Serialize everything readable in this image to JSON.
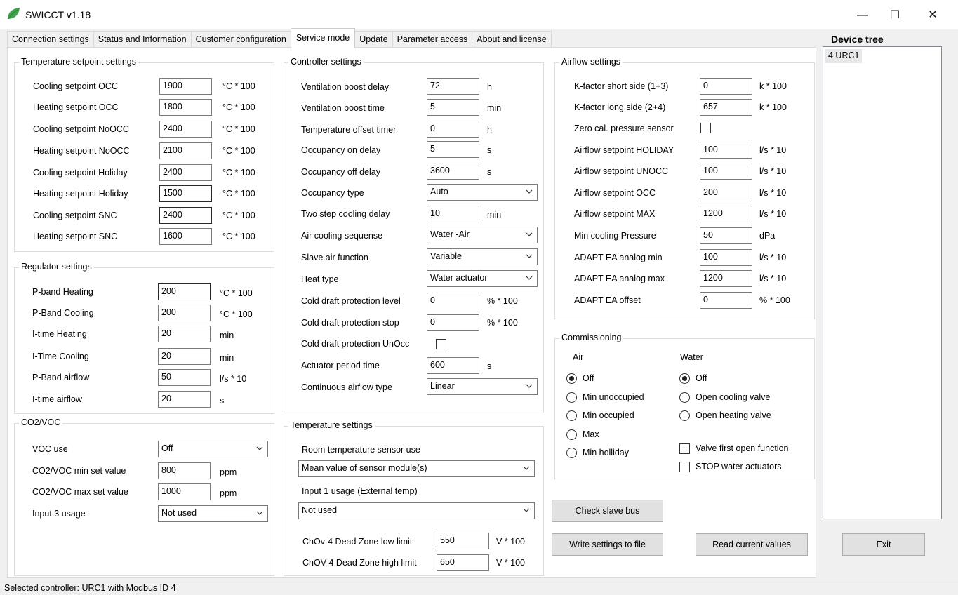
{
  "window": {
    "title": "SWICCT v1.18",
    "minimize": "—",
    "maximize": "☐",
    "close": "✕"
  },
  "tabs": [
    {
      "label": "Connection settings"
    },
    {
      "label": "Status and Information"
    },
    {
      "label": "Customer configuration"
    },
    {
      "label": "Service mode",
      "active": true
    },
    {
      "label": "Update"
    },
    {
      "label": "Parameter access"
    },
    {
      "label": "About and license"
    }
  ],
  "temperature_setpoint": {
    "title": "Temperature setpoint settings",
    "rows": [
      {
        "label": "Cooling setpoint OCC",
        "value": "1900",
        "unit": "°C * 100"
      },
      {
        "label": "Heating setpoint OCC",
        "value": "1800",
        "unit": "°C * 100"
      },
      {
        "label": "Cooling setpoint NoOCC",
        "value": "2400",
        "unit": "°C * 100"
      },
      {
        "label": "Heating setpoint NoOCC",
        "value": "2100",
        "unit": "°C * 100"
      },
      {
        "label": "Cooling setpoint Holiday",
        "value": "2400",
        "unit": "°C * 100"
      },
      {
        "label": "Heating setpoint Holiday",
        "value": "1500",
        "unit": "°C * 100"
      },
      {
        "label": "Cooling setpoint SNC",
        "value": "2400",
        "unit": "°C * 100"
      },
      {
        "label": "Heating setpoint SNC",
        "value": "1600",
        "unit": "°C * 100"
      }
    ]
  },
  "regulator": {
    "title": "Regulator settings",
    "rows": [
      {
        "label": "P-band Heating",
        "value": "200",
        "unit": "°C * 100"
      },
      {
        "label": "P-Band Cooling",
        "value": "200",
        "unit": "°C * 100"
      },
      {
        "label": "I-time Heating",
        "value": "20",
        "unit": "min"
      },
      {
        "label": "I-Time Cooling",
        "value": "20",
        "unit": "min"
      },
      {
        "label": "P-Band airflow",
        "value": "50",
        "unit": "l/s * 10"
      },
      {
        "label": "I-time airflow",
        "value": "20",
        "unit": "s"
      }
    ]
  },
  "co2voc": {
    "title": "CO2/VOC",
    "voc_use_label": "VOC use",
    "voc_use_value": "Off",
    "min_label": "CO2/VOC min set value",
    "min_value": "800",
    "min_unit": "ppm",
    "max_label": "CO2/VOC max set value",
    "max_value": "1000",
    "max_unit": "ppm",
    "input3_label": "Input 3 usage",
    "input3_value": "Not used"
  },
  "controller": {
    "title": "Controller settings",
    "rows": [
      {
        "label": "Ventilation boost delay",
        "value": "72",
        "unit": "h"
      },
      {
        "label": "Ventilation boost time",
        "value": "5",
        "unit": "min"
      },
      {
        "label": "Temperature offset timer",
        "value": "0",
        "unit": "h"
      },
      {
        "label": "Occupancy on delay",
        "value": "5",
        "unit": "s"
      },
      {
        "label": "Occupancy off delay",
        "value": "3600",
        "unit": "s"
      }
    ],
    "occupancy_type_label": "Occupancy type",
    "occupancy_type_value": "Auto",
    "two_step_label": "Two step cooling delay",
    "two_step_value": "10",
    "two_step_unit": "min",
    "air_cooling_label": "Air cooling sequense",
    "air_cooling_value": "Water -Air",
    "slave_air_label": "Slave air function",
    "slave_air_value": "Variable",
    "heat_type_label": "Heat type",
    "heat_type_value": "Water actuator",
    "cold_level_label": "Cold draft protection level",
    "cold_level_value": "0",
    "cold_level_unit": "% * 100",
    "cold_stop_label": "Cold draft protection stop",
    "cold_stop_value": "0",
    "cold_stop_unit": "% * 100",
    "cold_unocc_label": "Cold draft protection UnOcc",
    "actuator_label": "Actuator period time",
    "actuator_value": "600",
    "actuator_unit": "s",
    "cont_airflow_label": "Continuous airflow type",
    "cont_airflow_value": "Linear"
  },
  "temperature_settings": {
    "title": "Temperature settings",
    "room_sensor_label": "Room temperature sensor use",
    "room_sensor_value": "Mean value of sensor module(s)",
    "input1_label": "Input 1 usage (External temp)",
    "input1_value": "Not used",
    "low_label": "ChOv-4 Dead Zone low limit",
    "low_value": "550",
    "low_unit": "V * 100",
    "high_label": "ChOV-4 Dead Zone high limit",
    "high_value": "650",
    "high_unit": "V * 100"
  },
  "airflow": {
    "title": "Airflow settings",
    "kshort_label": "K-factor short side (1+3)",
    "kshort_value": "0",
    "kshort_unit": "k * 100",
    "klong_label": "K-factor long side (2+4)",
    "klong_value": "657",
    "klong_unit": "k * 100",
    "zero_label": "Zero cal. pressure sensor",
    "rows": [
      {
        "label": "Airflow setpoint HOLIDAY",
        "value": "100",
        "unit": "l/s * 10"
      },
      {
        "label": "Airflow setpoint UNOCC",
        "value": "100",
        "unit": "l/s * 10"
      },
      {
        "label": "Airflow setpoint OCC",
        "value": "200",
        "unit": "l/s * 10"
      },
      {
        "label": "Airflow setpoint MAX",
        "value": "1200",
        "unit": "l/s * 10"
      },
      {
        "label": "Min cooling Pressure",
        "value": "50",
        "unit": "dPa"
      },
      {
        "label": "ADAPT EA analog min",
        "value": "100",
        "unit": "l/s * 10"
      },
      {
        "label": "ADAPT EA analog max",
        "value": "1200",
        "unit": "l/s * 10"
      },
      {
        "label": "ADAPT EA offset",
        "value": "0",
        "unit": "% * 100"
      }
    ]
  },
  "commissioning": {
    "title": "Commissioning",
    "air_header": "Air",
    "water_header": "Water",
    "air_options": [
      "Off",
      "Min unoccupied",
      "Min occupied",
      "Max",
      "Min holliday"
    ],
    "air_selected": 0,
    "water_options": [
      "Off",
      "Open cooling valve",
      "Open heating valve"
    ],
    "water_selected": 0,
    "valve_first_label": "Valve first open function",
    "stop_water_label": "STOP water actuators"
  },
  "buttons": {
    "check_slave": "Check slave bus",
    "write_settings": "Write settings to file",
    "read_values": "Read current values",
    "exit": "Exit"
  },
  "device_tree": {
    "title": "Device tree",
    "items": [
      "4 URC1"
    ]
  },
  "status_bar": {
    "text": "Selected controller: URC1 with Modbus ID 4"
  },
  "colors": {
    "window_bg": "#f0f0f0",
    "panel_bg": "#ffffff",
    "icon_leaf": "#4caf50"
  }
}
